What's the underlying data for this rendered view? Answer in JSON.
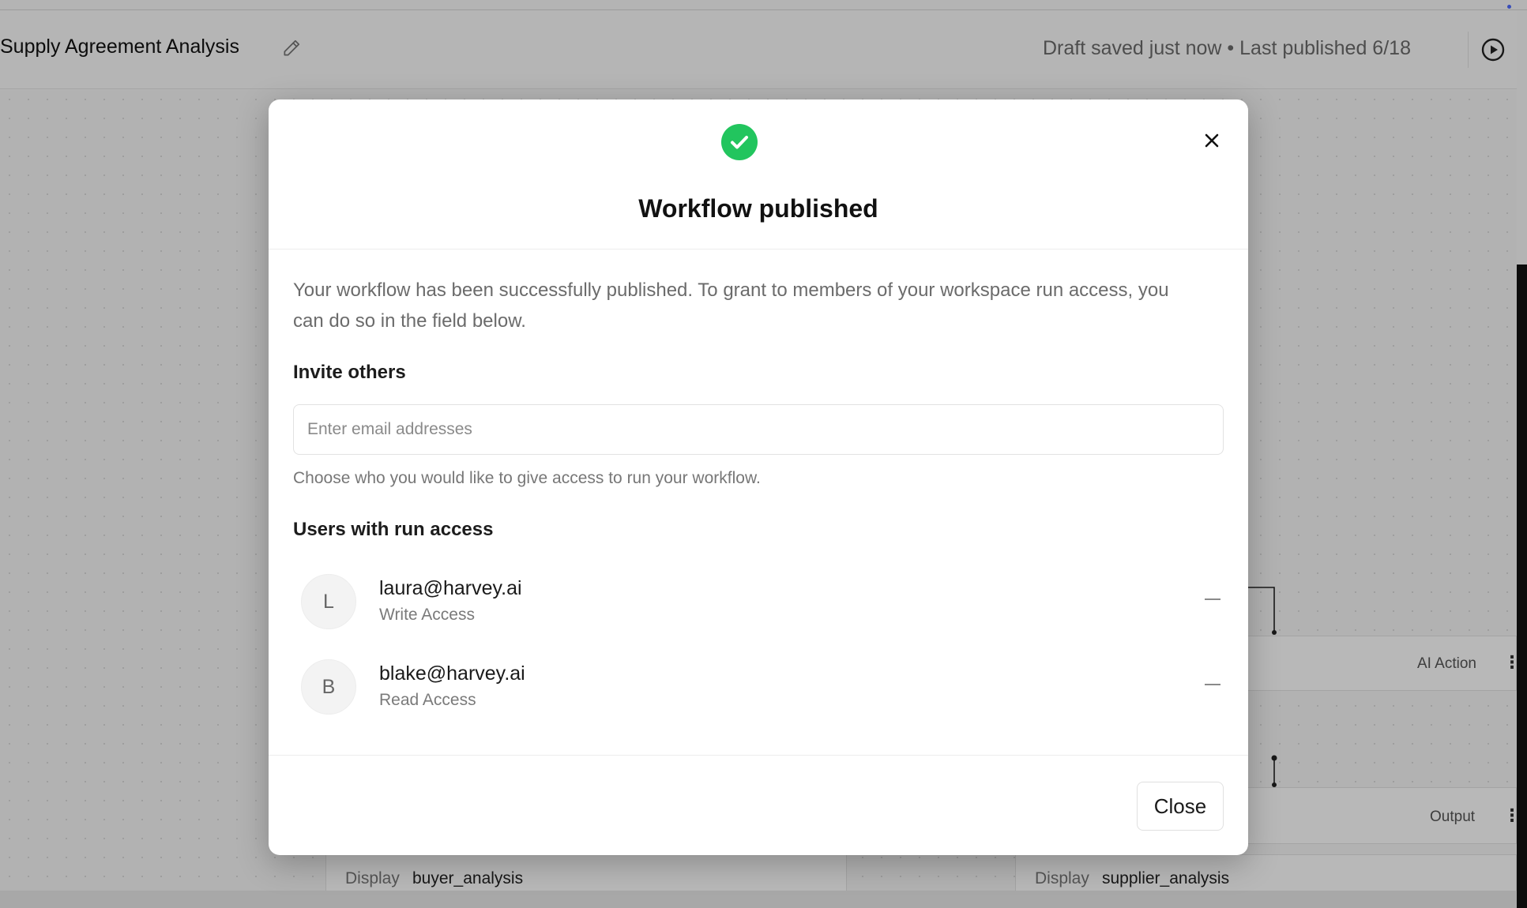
{
  "header": {
    "title": "Supply Agreement Analysis",
    "status": "Draft saved just now • Last published 6/18"
  },
  "canvas": {
    "nodes": [
      {
        "tag": "AI Action"
      },
      {
        "tag": "Output"
      }
    ],
    "bottom_cells": [
      {
        "prefix": "Display",
        "value": "buyer_analysis"
      },
      {
        "prefix": "Display",
        "value": "supplier_analysis"
      }
    ]
  },
  "modal": {
    "title": "Workflow published",
    "description": "Your workflow has been successfully published. To grant to members of your workspace run access, you can do so in the field below.",
    "invite_label": "Invite others",
    "email_placeholder": "Enter email addresses",
    "hint": "Choose who you would like to give access to run your workflow.",
    "users_label": "Users with run access",
    "users": [
      {
        "initial": "L",
        "email": "laura@harvey.ai",
        "role": "Write Access"
      },
      {
        "initial": "B",
        "email": "blake@harvey.ai",
        "role": "Read Access"
      }
    ],
    "close_label": "Close",
    "success_color": "#22c55e"
  },
  "icons": [
    "edit-icon",
    "play-icon",
    "check-circle-icon",
    "close-icon",
    "minus-icon",
    "more-vertical-icon"
  ]
}
